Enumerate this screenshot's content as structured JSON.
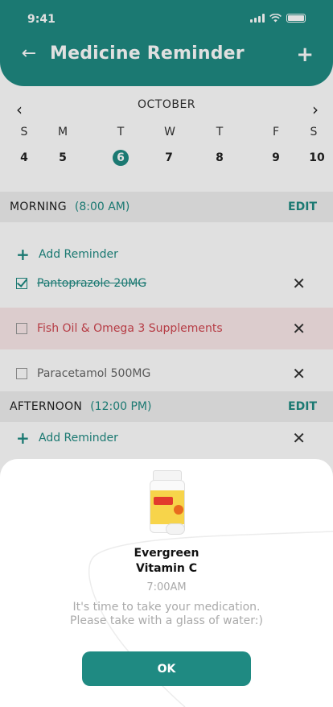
{
  "status_bar": {
    "time": "9:41"
  },
  "header": {
    "title": "Medicine Reminder",
    "back_icon": "←",
    "add_icon": "+"
  },
  "calendar": {
    "month": "OCTOBER",
    "prev_icon": "‹",
    "next_icon": "›",
    "weekdays": [
      "S",
      "M",
      "T",
      "W",
      "T",
      "F",
      "S"
    ],
    "dates": [
      "4",
      "5",
      "6",
      "7",
      "8",
      "9",
      "10"
    ],
    "selected_index": 2
  },
  "morning": {
    "label": "MORNING",
    "time": "(8:00 AM)",
    "edit": "EDIT",
    "add_label": "Add Reminder",
    "items": [
      {
        "label": "Pantoprazole 20MG",
        "checked": true
      },
      {
        "label": "Fish Oil & Omega 3 Supplements",
        "checked": false
      },
      {
        "label": "Paracetamol 500MG",
        "checked": false
      }
    ]
  },
  "afternoon": {
    "label": "AFTERNOON",
    "time": "(12:00 PM)",
    "edit": "EDIT",
    "add_label": "Add Reminder"
  },
  "popup": {
    "name_line1": "Evergreen",
    "name_line2": "Vitamin C",
    "time": "7:00AM",
    "message_line1": "It's time to take your medication.",
    "message_line2": "Please take with a glass of water:)",
    "ok_label": "OK"
  },
  "colors": {
    "accent": "#1f8a82",
    "alert": "#d0454f"
  },
  "icons": {
    "close": "✕",
    "plus": "+"
  }
}
